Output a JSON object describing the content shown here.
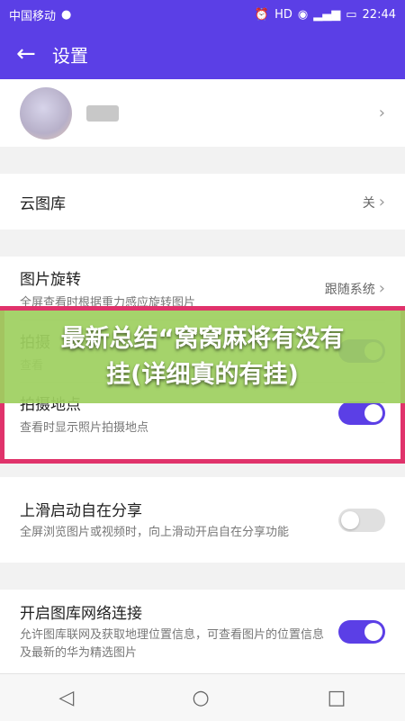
{
  "status": {
    "carrier": "中国移动",
    "time": "22:44",
    "icons": [
      "wechat-icon",
      "alarm-icon",
      "hd-icon",
      "eye-icon",
      "signal-icon",
      "battery-icon"
    ]
  },
  "appbar": {
    "title": "设置",
    "back_icon": "arrow-left-icon"
  },
  "sections": {
    "cloud": {
      "label": "云图库",
      "value": "关"
    },
    "rotate": {
      "label": "图片旋转",
      "sub": "全屏查看时根据重力感应旋转图片",
      "value": "跟随系统"
    },
    "capture_time": {
      "label": "拍摄",
      "sub": "查看",
      "on": true
    },
    "location": {
      "label": "拍摄地点",
      "sub": "查看时显示照片拍摄地点",
      "on": true
    },
    "swipe_share": {
      "label": "上滑启动自在分享",
      "sub": "全屏浏览图片或视频时，向上滑动开启自在分享功能",
      "on": false
    },
    "network": {
      "label": "开启图库网络连接",
      "sub": "允许图库联网及获取地理位置信息，可查看图片的位置信息及最新的华为精选图片",
      "on": true
    }
  },
  "banner": {
    "text": "最新总结“窝窝麻将有没有挂(详细真的有挂)"
  },
  "colors": {
    "accent": "#5b3fe6",
    "banner": "#9ed060",
    "highlight": "#e0336b"
  }
}
